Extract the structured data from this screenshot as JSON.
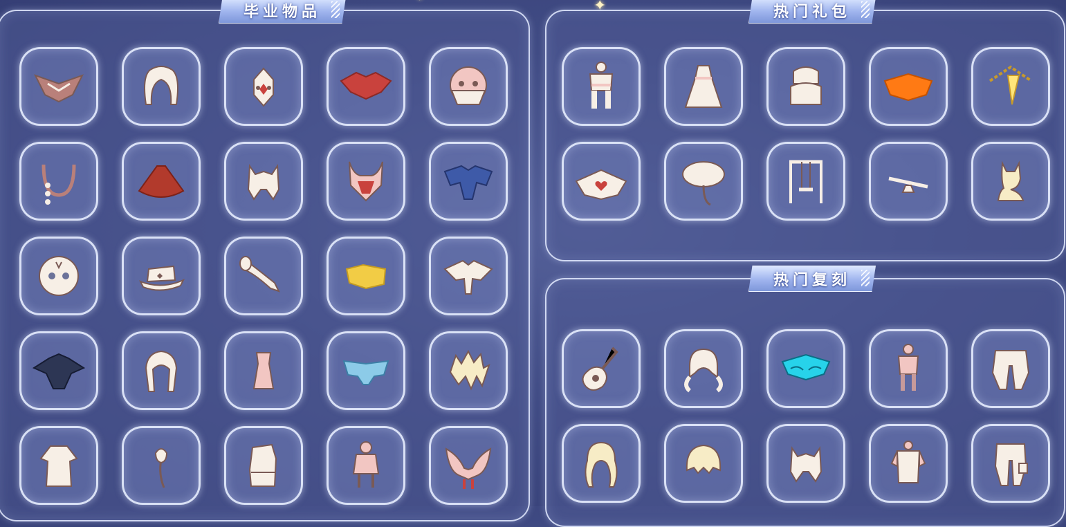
{
  "panels": {
    "graduation": {
      "title": "毕业物品",
      "items": [
        {
          "icon": "brown-wing-cape-icon"
        },
        {
          "icon": "white-braid-hair-icon"
        },
        {
          "icon": "feather-mask-icon"
        },
        {
          "icon": "red-cape-icon"
        },
        {
          "icon": "round-mask-icon"
        },
        {
          "icon": "horn-accessory-icon"
        },
        {
          "icon": "red-cloak-icon"
        },
        {
          "icon": "cat-ear-hair-icon"
        },
        {
          "icon": "red-horn-mask-icon"
        },
        {
          "icon": "blue-cape-icon"
        },
        {
          "icon": "white-mask-icon"
        },
        {
          "icon": "hat-icon"
        },
        {
          "icon": "horn-instrument-icon"
        },
        {
          "icon": "yellow-cape-icon"
        },
        {
          "icon": "white-cape-icon"
        },
        {
          "icon": "dark-cape-icon"
        },
        {
          "icon": "long-hair-icon"
        },
        {
          "icon": "pink-outfit-icon"
        },
        {
          "icon": "blue-butterfly-cape-icon"
        },
        {
          "icon": "spiky-hair-icon"
        },
        {
          "icon": "white-robe-icon"
        },
        {
          "icon": "flower-prop-icon"
        },
        {
          "icon": "boot-icon"
        },
        {
          "icon": "pink-outfit-figure-icon"
        },
        {
          "icon": "winged-headpiece-icon"
        }
      ]
    },
    "hot_packs": {
      "title": "热门礼包",
      "items": [
        {
          "icon": "white-outfit-icon"
        },
        {
          "icon": "white-dress-icon"
        },
        {
          "icon": "fur-hat-icon"
        },
        {
          "icon": "orange-cape-icon"
        },
        {
          "icon": "yellow-necklace-icon"
        },
        {
          "icon": "heart-cape-icon"
        },
        {
          "icon": "leaf-umbrella-icon"
        },
        {
          "icon": "swing-icon"
        },
        {
          "icon": "seesaw-icon"
        },
        {
          "icon": "fox-icon"
        }
      ]
    },
    "hot_reruns": {
      "title": "热门复刻",
      "items": [
        {
          "icon": "guitar-icon"
        },
        {
          "icon": "pigtail-hair-icon"
        },
        {
          "icon": "cyan-cape-icon"
        },
        {
          "icon": "pink-armor-outfit-icon"
        },
        {
          "icon": "puffy-pants-icon"
        },
        {
          "icon": "wavy-hair-icon"
        },
        {
          "icon": "short-hair-icon"
        },
        {
          "icon": "cat-ear-hair-icon"
        },
        {
          "icon": "pink-top-icon"
        },
        {
          "icon": "cargo-pants-icon"
        }
      ]
    }
  }
}
